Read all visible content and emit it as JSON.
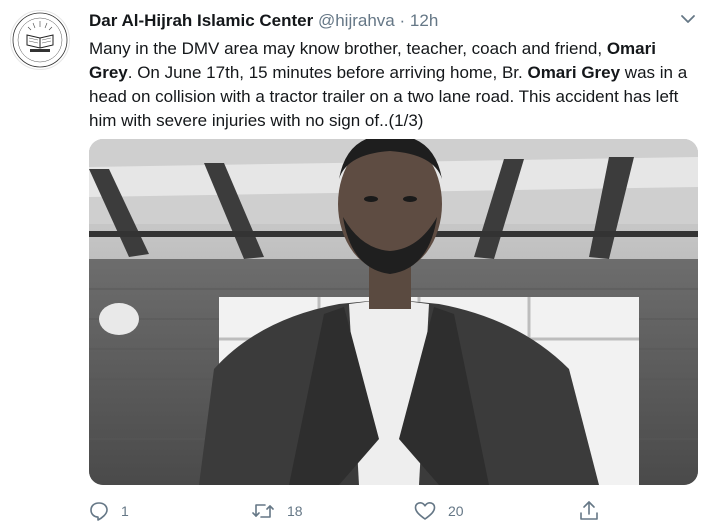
{
  "tweet": {
    "display_name": "Dar Al-Hijrah Islamic Center",
    "handle": "@hijrahva",
    "separator": "·",
    "time": "12h",
    "text_parts": [
      "Many in the DMV area may know brother, teacher, coach and friend, ",
      "Omari Grey",
      ". On June 17th, 15 minutes before arriving home, Br. ",
      "Omari Grey",
      " was in a head on collision with a tractor trailer on a two lane road. This accident has left him with severe injuries with no sign of..(1/3)"
    ]
  },
  "avatar": {
    "logo_text_top": "Dar",
    "logo_text_bottom": "AL-HIJRAH"
  },
  "actions": {
    "reply_count": "1",
    "retweet_count": "18",
    "like_count": "20"
  },
  "icons": {
    "caret": "chevron-down-icon",
    "reply": "reply-icon",
    "retweet": "retweet-icon",
    "like": "heart-icon",
    "share": "share-icon"
  },
  "colors": {
    "name": "#14171a",
    "meta": "#657786"
  }
}
